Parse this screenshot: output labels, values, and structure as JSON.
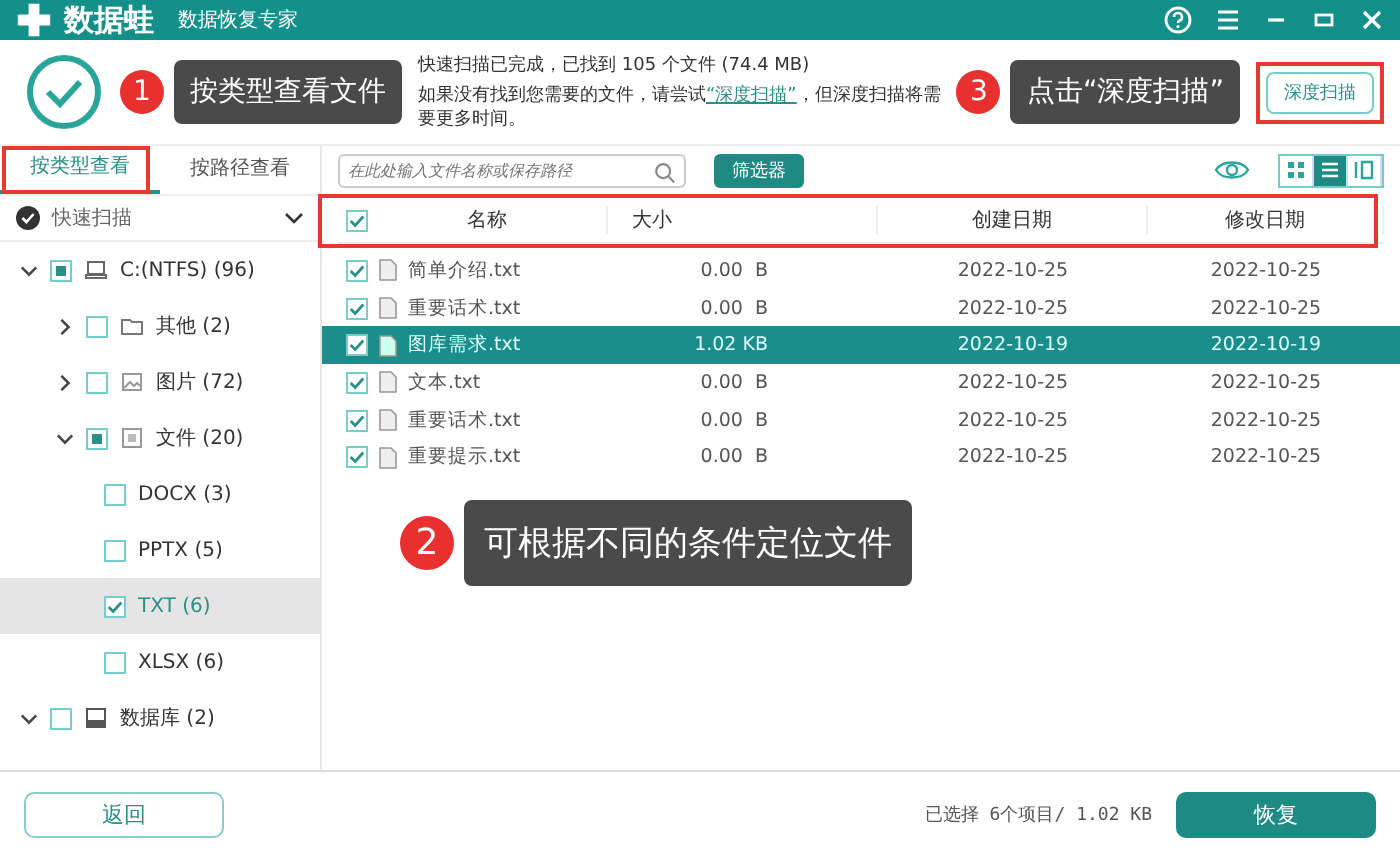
{
  "window": {
    "app_name": "数据蛙",
    "subtitle": "数据恢复专家"
  },
  "scan_summary": {
    "line_1": "快速扫描已完成，已找到 105 个文件 (74.4 MB)",
    "line_2_before": "如果没有找到您需要的文件，请尝试",
    "link": "“深度扫描”",
    "line_2_after": "，但深度扫描将需要更多时间。"
  },
  "deep_scan_button": "深度扫描",
  "view_tabs": [
    {
      "label": "按类型查看",
      "selected": true
    },
    {
      "label": "按路径查看",
      "selected": false
    }
  ],
  "scan_mode": {
    "label": "快速扫描"
  },
  "tree": [
    {
      "label": "C:(NTFS) (96)",
      "kind": "drive",
      "checked": true,
      "partial": true,
      "expanded": true,
      "selected": false,
      "children": [
        {
          "label": "其他 (2)",
          "kind": "folder",
          "checked": false,
          "partial": false,
          "expanded": false,
          "selected": false
        },
        {
          "label": "图片 (72)",
          "kind": "image",
          "checked": false,
          "partial": false,
          "expanded": false,
          "selected": false
        },
        {
          "label": "文件 (20)",
          "kind": "doc",
          "checked": true,
          "partial": true,
          "expanded": true,
          "selected": false,
          "children": [
            {
              "kind": "type",
              "label": "DOCX (3)",
              "checked": false,
              "partial": false,
              "selected": false
            },
            {
              "kind": "type",
              "label": "PPTX (5)",
              "checked": false,
              "partial": false,
              "selected": false
            },
            {
              "kind": "type",
              "label": "TXT (6)",
              "checked": true,
              "partial": false,
              "selected": true
            },
            {
              "kind": "type",
              "label": "XLSX (6)",
              "checked": false,
              "partial": false,
              "selected": false
            }
          ]
        }
      ]
    },
    {
      "label": "数据库 (2)",
      "kind": "database",
      "checked": false,
      "partial": false,
      "expanded": true,
      "selected": false
    }
  ],
  "search": {
    "placeholder": "在此处输入文件名称或保存路径"
  },
  "filter_button": "筛选器",
  "view_modes": [
    {
      "kind": "grid",
      "selected": false
    },
    {
      "kind": "list",
      "selected": true
    },
    {
      "kind": "detail",
      "selected": false
    }
  ],
  "table": {
    "all_checked": true,
    "columns": [
      "名称",
      "大小",
      "创建日期",
      "修改日期"
    ],
    "rows": [
      {
        "name": "简单介绍.txt",
        "size": "0.00  B",
        "created": "2022-10-25",
        "modified": "2022-10-25",
        "checked": true,
        "selected": false
      },
      {
        "name": "重要话术.txt",
        "size": "0.00  B",
        "created": "2022-10-25",
        "modified": "2022-10-25",
        "checked": true,
        "selected": false
      },
      {
        "name": "图库需求.txt",
        "size": "1.02 KB",
        "created": "2022-10-19",
        "modified": "2022-10-19",
        "checked": true,
        "selected": true
      },
      {
        "name": "文本.txt",
        "size": "0.00  B",
        "created": "2022-10-25",
        "modified": "2022-10-25",
        "checked": true,
        "selected": false
      },
      {
        "name": "重要话术.txt",
        "size": "0.00  B",
        "created": "2022-10-25",
        "modified": "2022-10-25",
        "checked": true,
        "selected": false
      },
      {
        "name": "重要提示.txt",
        "size": "0.00  B",
        "created": "2022-10-25",
        "modified": "2022-10-25",
        "checked": true,
        "selected": false
      }
    ]
  },
  "footer": {
    "back_button": "返回",
    "selection_status": "已选择 6个项目/ 1.02 KB",
    "recover_button": "恢复"
  },
  "annotations": [
    {
      "number": "1",
      "text": "按类型查看文件"
    },
    {
      "number": "2",
      "text": "可根据不同的条件定位文件"
    },
    {
      "number": "3",
      "text": "点击“深度扫描”"
    }
  ]
}
